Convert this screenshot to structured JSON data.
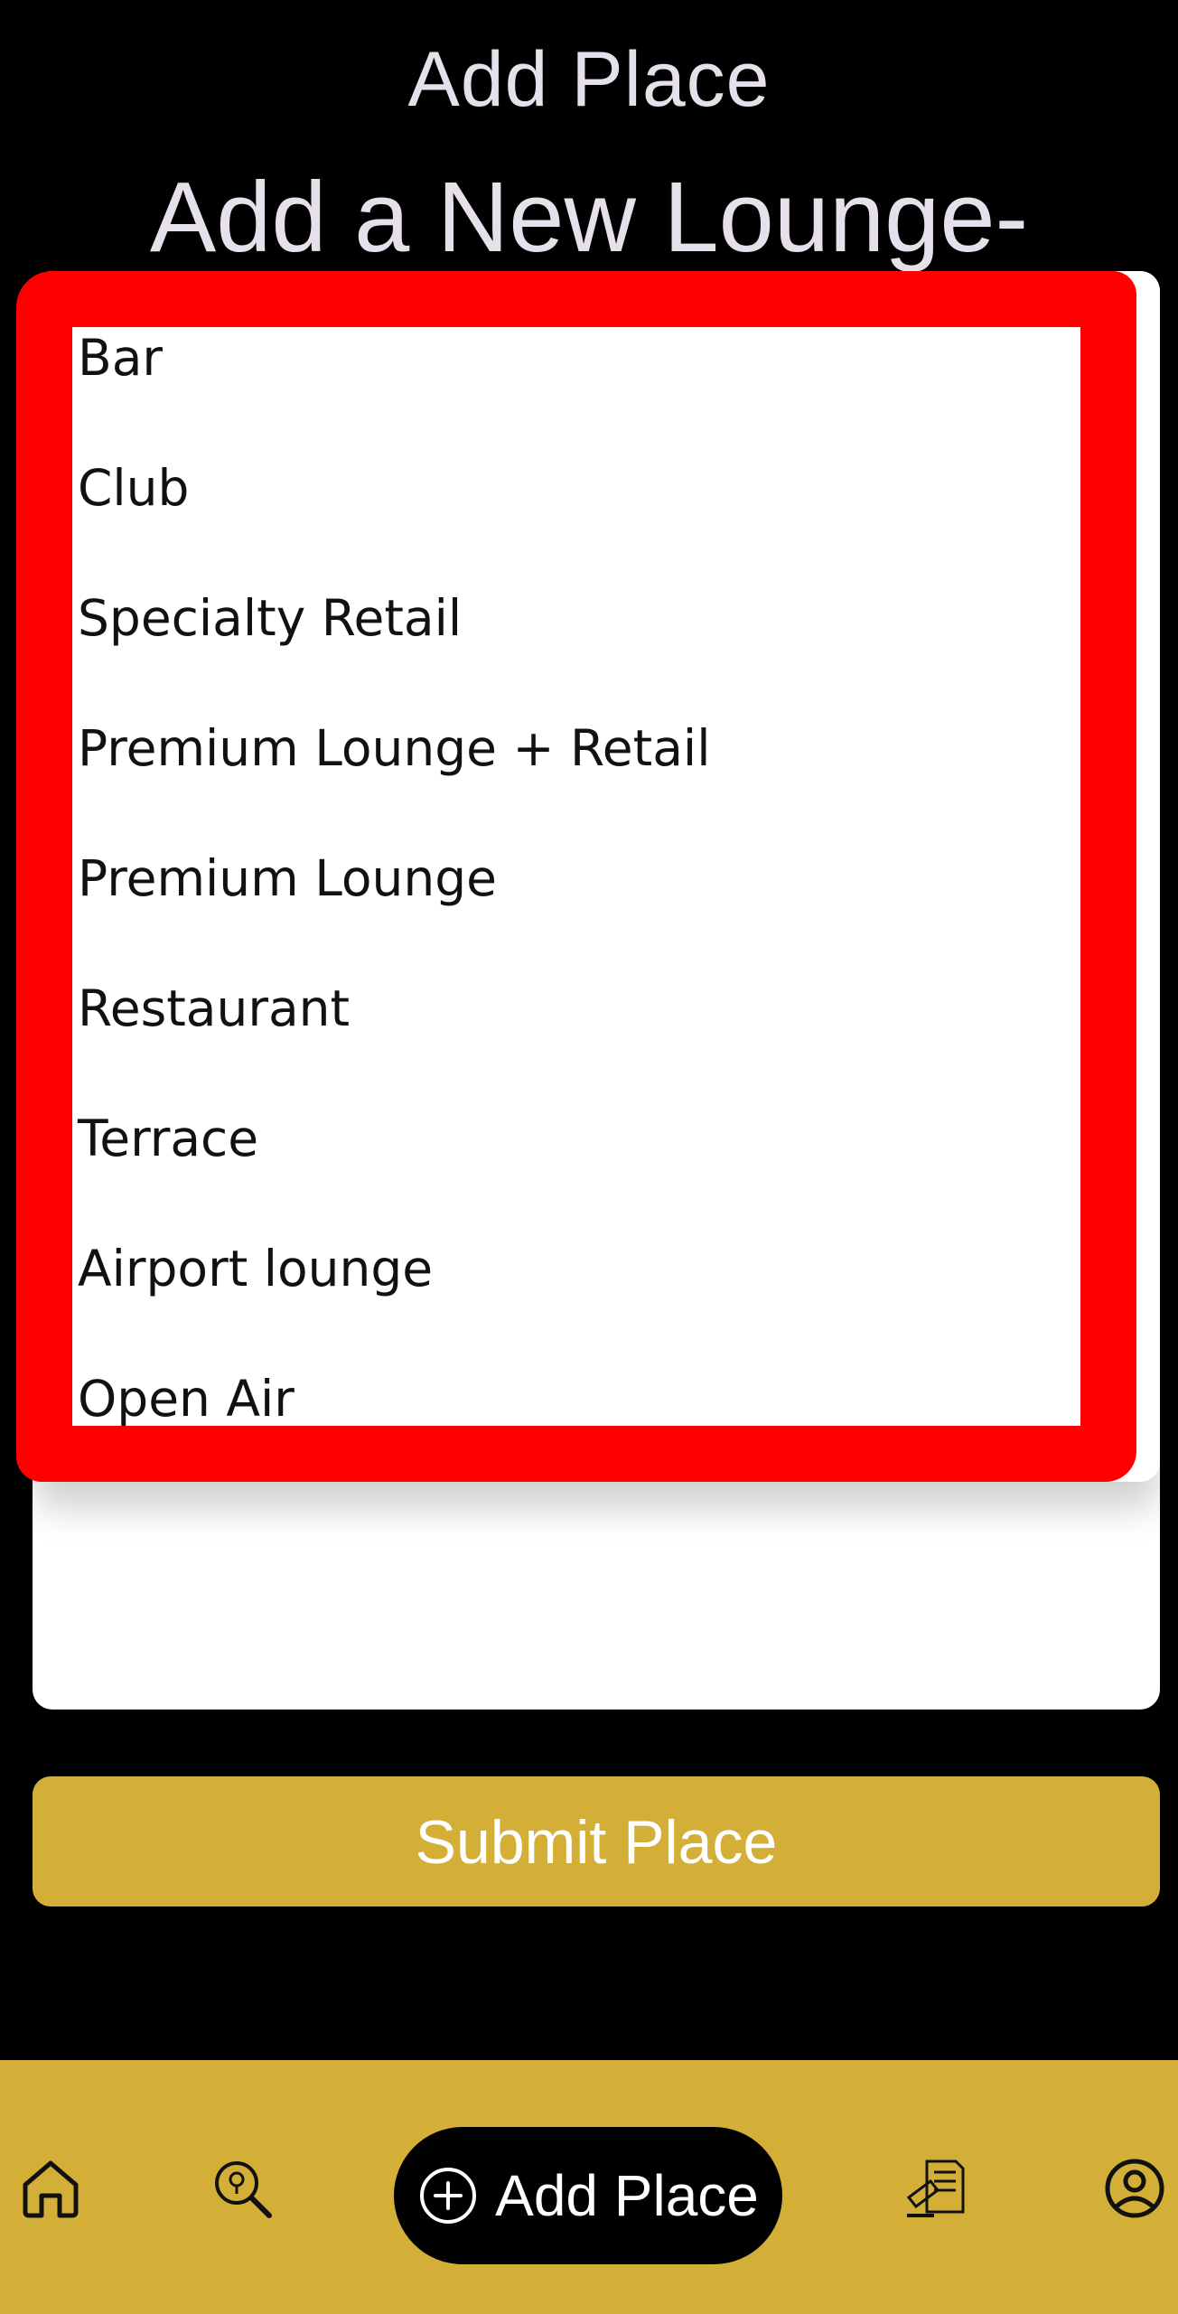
{
  "header": {
    "title": "Add Place"
  },
  "form": {
    "title": "Add a New Lounge-"
  },
  "dropdown": {
    "items": [
      "Bar",
      "Club",
      "Specialty Retail",
      "Premium Lounge + Retail",
      "Premium Lounge",
      "Restaurant",
      "Terrace",
      "Airport lounge",
      "Open Air"
    ]
  },
  "actions": {
    "submit_label": "Submit Place"
  },
  "bottom_nav": {
    "add_place_label": "Add Place",
    "icons": [
      "home-icon",
      "search-location-icon",
      "add-circle-icon",
      "reviews-icon",
      "profile-icon"
    ]
  },
  "colors": {
    "background": "#000000",
    "accent_gold": "#d4af37",
    "highlight_red": "#ff0000",
    "text_light": "#e6e0ea"
  }
}
